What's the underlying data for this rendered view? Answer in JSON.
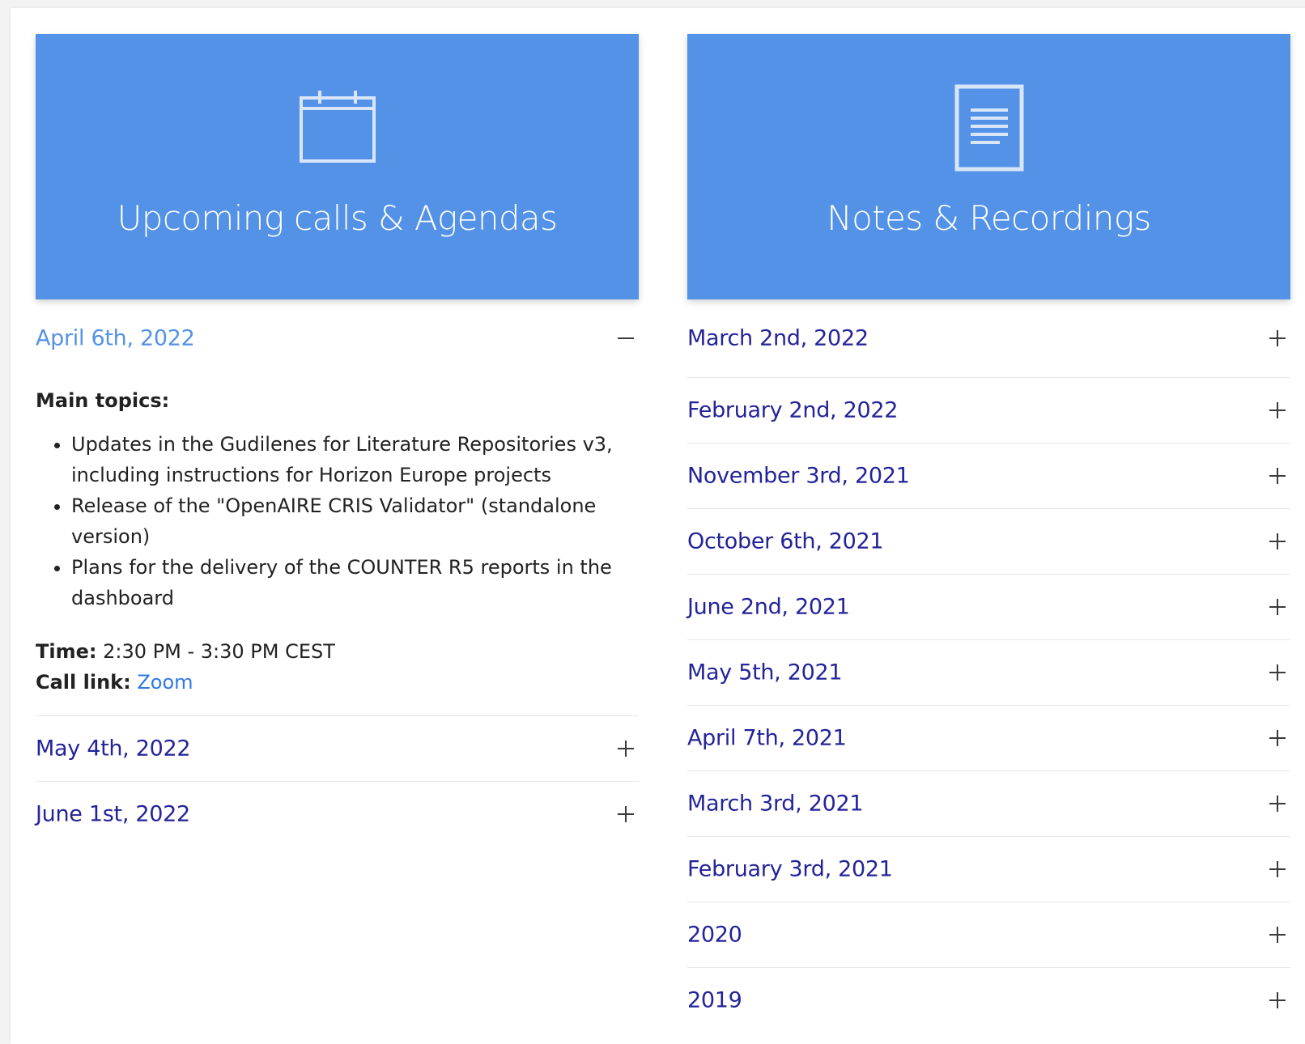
{
  "upcoming": {
    "title": "Upcoming calls & Agendas",
    "icon": "calendar-icon",
    "items": [
      {
        "date": "April 6th, 2022",
        "expanded": true,
        "topics_label": "Main topics:",
        "topics": [
          "Updates in the Gudilenes for Literature Repositories v3, including instructions for Horizon Europe projects",
          "Release of the \"OpenAIRE CRIS Validator\" (standalone version)",
          "Plans for the delivery of the COUNTER R5 reports in the dashboard"
        ],
        "time_label": "Time:",
        "time_value": "2:30 PM - 3:30 PM CEST",
        "call_link_label": "Call link:",
        "call_link_text": "Zoom"
      },
      {
        "date": "May 4th, 2022",
        "expanded": false
      },
      {
        "date": "June 1st, 2022",
        "expanded": false
      }
    ]
  },
  "notes": {
    "title": "Notes & Recordings",
    "icon": "document-icon",
    "items": [
      "March 2nd, 2022",
      "February 2nd, 2022",
      "November 3rd, 2021",
      "October 6th, 2021",
      "June 2nd, 2021",
      "May 5th, 2021",
      "April 7th, 2021",
      "March 3rd, 2021",
      "February 3rd, 2021",
      "2020",
      "2019"
    ]
  },
  "colors": {
    "hero_bg": "#5492e7",
    "link_dark": "#23239a",
    "link_active": "#5492e7"
  }
}
